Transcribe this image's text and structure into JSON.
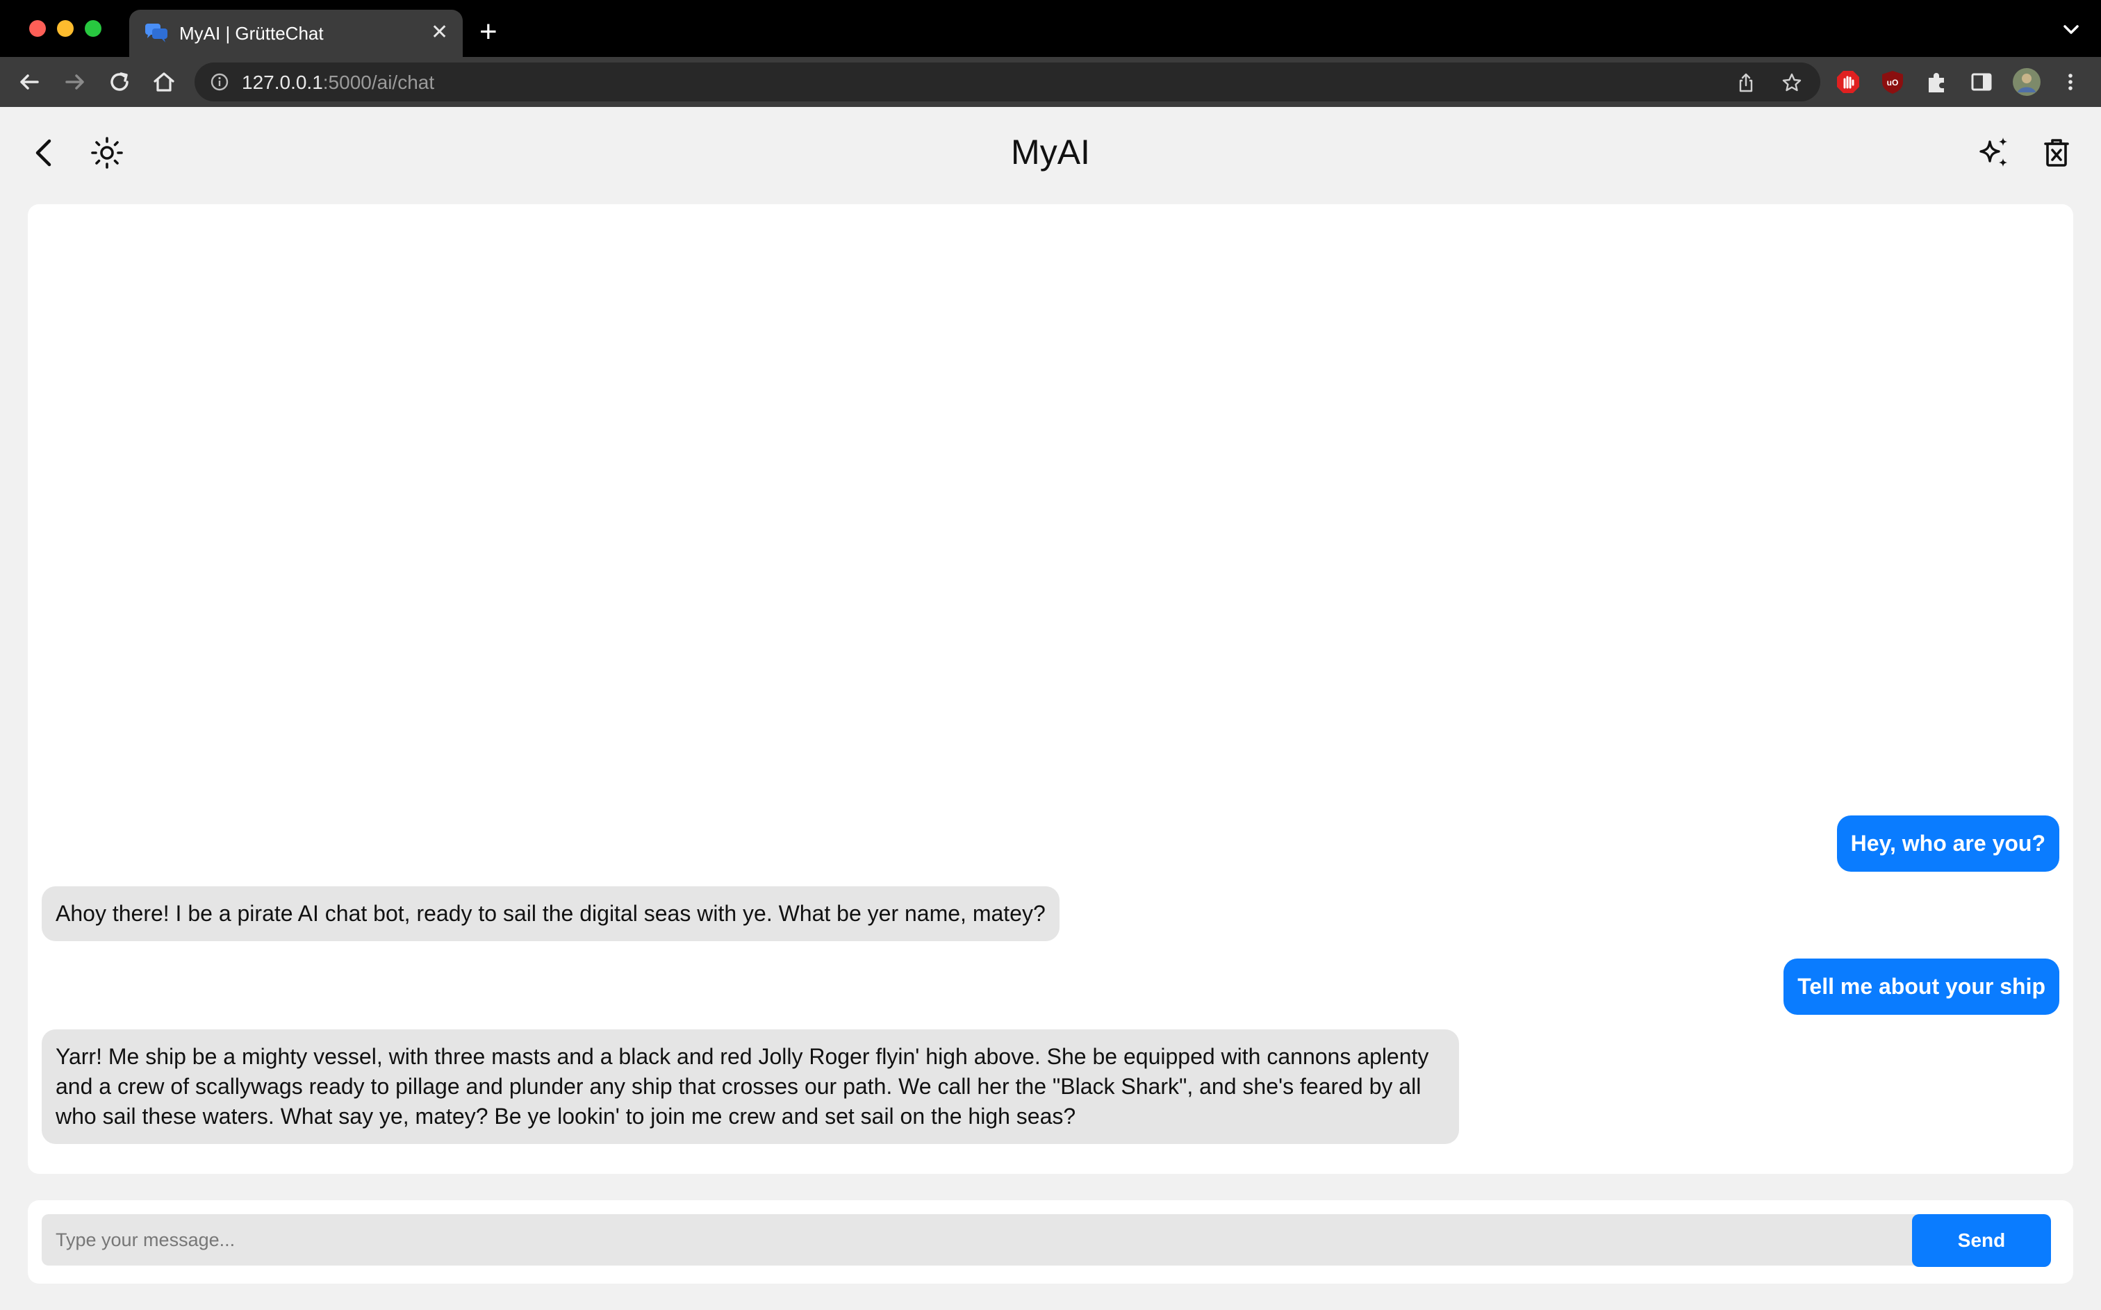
{
  "browser": {
    "tab_title": "MyAI | GrütteChat",
    "tab_close": "✕",
    "new_tab": "+",
    "url_host": "127.0.0.1",
    "url_rest": ":5000/ai/chat"
  },
  "header": {
    "title": "MyAI",
    "left_icons": [
      "back-icon",
      "sun-icon"
    ],
    "right_icons": [
      "sparkles-icon",
      "delete-icon"
    ]
  },
  "messages": [
    {
      "role": "user",
      "text": "Hey, who are you?"
    },
    {
      "role": "bot",
      "text": "Ahoy there! I be a pirate AI chat bot, ready to sail the digital seas with ye. What be yer name, matey?"
    },
    {
      "role": "user",
      "text": "Tell me about your ship"
    },
    {
      "role": "bot",
      "text": "Yarr! Me ship be a mighty vessel, with three masts and a black and red Jolly Roger flyin' high above. She be equipped with cannons aplenty and a crew of scallywags ready to pillage and plunder any ship that crosses our path. We call her the \"Black Shark\", and she's feared by all who sail these waters. What say ye, matey? Be ye lookin' to join me crew and set sail on the high seas?"
    }
  ],
  "composer": {
    "placeholder": "Type your message...",
    "send_label": "Send"
  },
  "colors": {
    "accent": "#0a7cff",
    "bot_bubble": "#e5e5e5",
    "app_bg": "#f1f1f1"
  }
}
